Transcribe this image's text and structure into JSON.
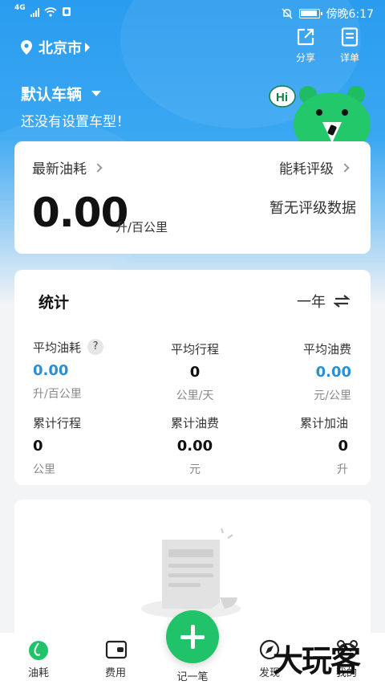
{
  "status_bar": {
    "network": "4G",
    "time_label": "傍晚6:17"
  },
  "header": {
    "city": "北京市",
    "share_label": "分享",
    "detail_label": "详单"
  },
  "vehicle": {
    "name": "默认车辆",
    "subtitle": "还没有设置车型！"
  },
  "fuel_card": {
    "latest_label": "最新油耗",
    "rating_label": "能耗评级",
    "value": "0.00",
    "unit": "升/百公里",
    "rating_empty": "暂无评级数据"
  },
  "stats": {
    "title": "统计",
    "period": "一年",
    "help": "?",
    "items": [
      {
        "label": "平均油耗",
        "value": "0.00",
        "unit": "升/百公里"
      },
      {
        "label": "平均行程",
        "value": "0",
        "unit": "公里/天"
      },
      {
        "label": "平均油费",
        "value": "0.00",
        "unit": "元/公里"
      },
      {
        "label": "累计行程",
        "value": "0",
        "unit": "公里"
      },
      {
        "label": "累计油费",
        "value": "0.00",
        "unit": "元"
      },
      {
        "label": "累计加油",
        "value": "0",
        "unit": "升"
      }
    ]
  },
  "tabs": [
    {
      "label": "油耗"
    },
    {
      "label": "费用"
    },
    {
      "label": "记一笔"
    },
    {
      "label": "发现"
    },
    {
      "label": "我的"
    }
  ],
  "mascot_greeting": "Hi",
  "watermark": "大玩客",
  "colors": {
    "primary_blue": "#2a9cef",
    "accent_green": "#20c36a",
    "value_blue": "#2a8fd6"
  }
}
